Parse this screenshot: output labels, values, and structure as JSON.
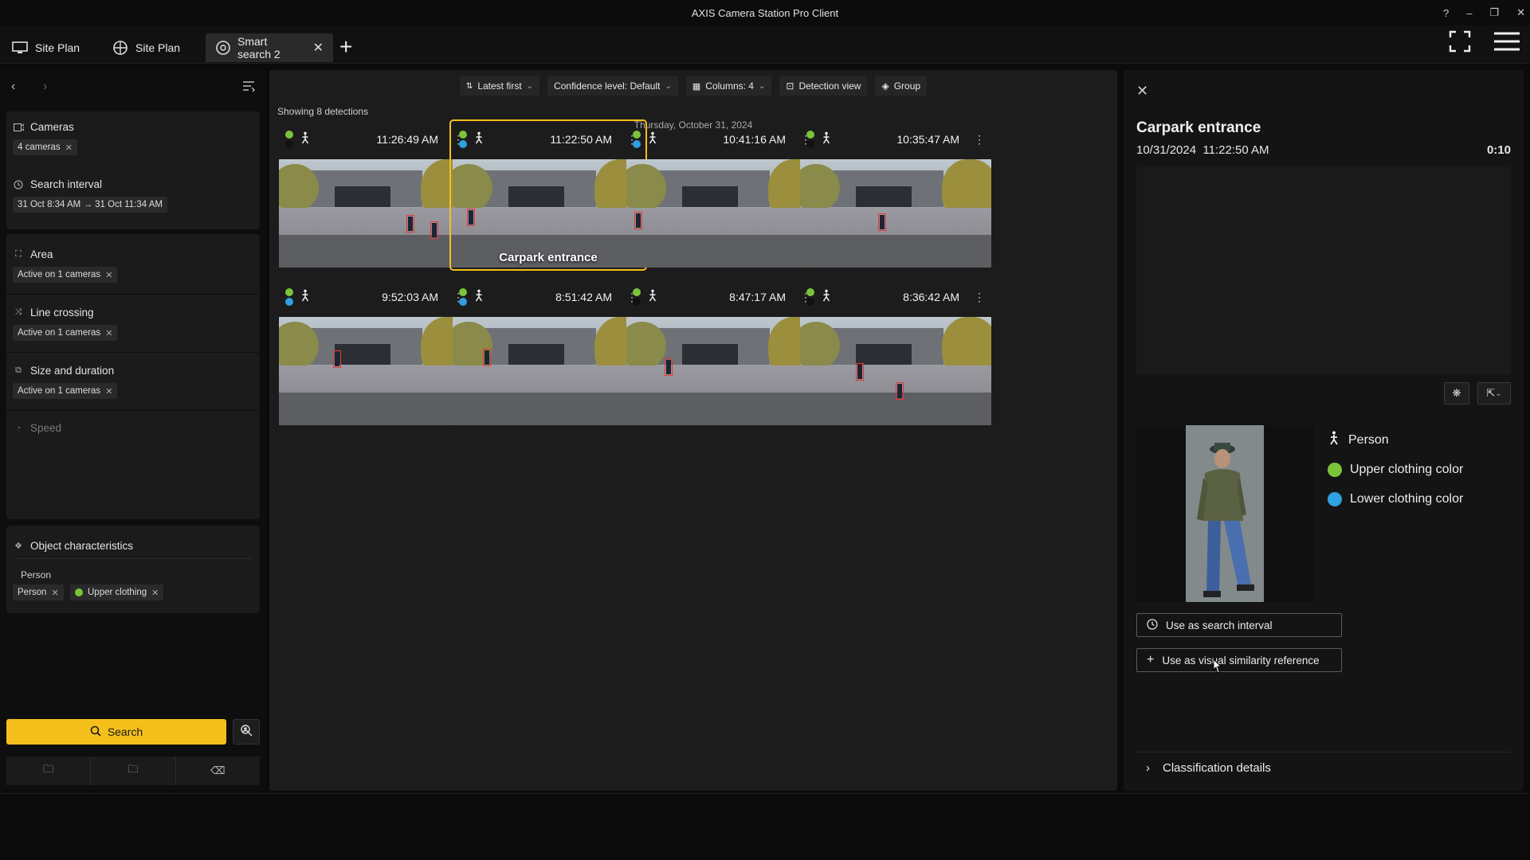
{
  "window": {
    "title": "AXIS Camera Station Pro Client",
    "controls": [
      "?",
      "–",
      "❐",
      "✕"
    ]
  },
  "tabs": [
    {
      "label": "Site Plan",
      "icon": "monitor-icon"
    },
    {
      "label": "Site Plan",
      "icon": "globe-icon"
    },
    {
      "label": "Smart search 2",
      "icon": "smart-search-icon",
      "active": true
    }
  ],
  "filters": {
    "cameras": {
      "title": "Cameras",
      "chip": "4 cameras"
    },
    "interval": {
      "title": "Search interval",
      "chip": "31 Oct 8:34 AM → 31 Oct 11:34 AM"
    },
    "area": {
      "title": "Area",
      "chip": "Active on 1 cameras"
    },
    "line": {
      "title": "Line crossing",
      "chip": "Active on 1 cameras"
    },
    "size": {
      "title": "Size and duration",
      "chip": "Active on 1 cameras"
    },
    "speed": {
      "title": "Speed"
    },
    "object": {
      "title": "Object characteristics",
      "subheader": "Person",
      "chip1": "Person",
      "chip2": "Upper clothing"
    },
    "search_label": "Search"
  },
  "toolbar": {
    "sort": "Latest first",
    "confidence": "Confidence level: Default",
    "columns": "Columns: 4",
    "detection_view": "Detection view",
    "group": "Group"
  },
  "results": {
    "showing": "Showing 8 detections",
    "date": "Thursday, October 31, 2024",
    "items": [
      {
        "time": "11:26:49 AM",
        "dot1": "#7bc43a",
        "dot2": "#111111",
        "label": ""
      },
      {
        "time": "11:22:50 AM",
        "dot1": "#7bc43a",
        "dot2": "#2fa0e0",
        "label": "Carpark entrance",
        "selected": true
      },
      {
        "time": "10:41:16 AM",
        "dot1": "#7bc43a",
        "dot2": "#2fa0e0",
        "label": ""
      },
      {
        "time": "10:35:47 AM",
        "dot1": "#7bc43a",
        "dot2": "#111111",
        "label": ""
      },
      {
        "time": "9:52:03 AM",
        "dot1": "#7bc43a",
        "dot2": "#2fa0e0",
        "label": ""
      },
      {
        "time": "8:51:42 AM",
        "dot1": "#7bc43a",
        "dot2": "#2fa0e0",
        "label": ""
      },
      {
        "time": "8:47:17 AM",
        "dot1": "#7bc43a",
        "dot2": "#111111",
        "label": ""
      },
      {
        "time": "8:36:42 AM",
        "dot1": "#7bc43a",
        "dot2": "#111111",
        "label": ""
      }
    ]
  },
  "detail": {
    "title": "Carpark entrance",
    "date": "10/31/2024",
    "time": "11:22:50 AM",
    "duration": "0:10",
    "attr_person": "Person",
    "attr_upper": "Upper clothing color",
    "attr_lower": "Lower clothing color",
    "upper_color": "#7bc43a",
    "lower_color": "#2fa0e0",
    "btn_interval": "Use as search interval",
    "btn_similarity": "Use as visual similarity reference",
    "classification": "Classification details"
  },
  "colors": {
    "accent": "#f5bf1b",
    "upper": "#7bc43a",
    "lower": "#2fa0e0"
  }
}
